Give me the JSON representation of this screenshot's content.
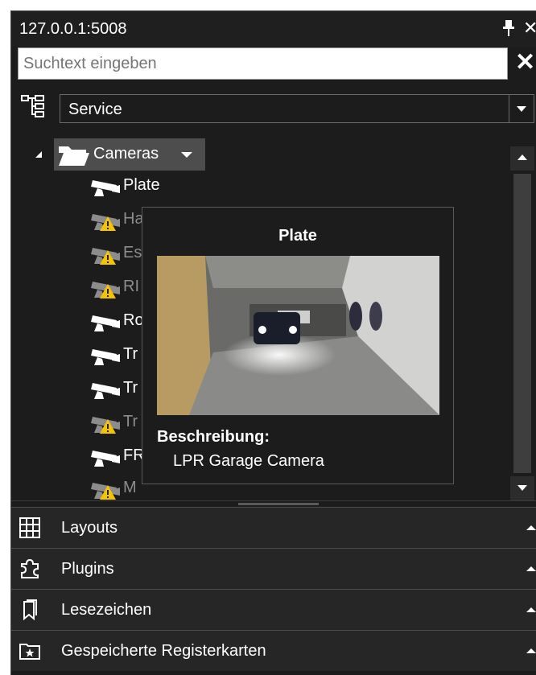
{
  "window": {
    "title": "127.0.0.1:5008"
  },
  "search": {
    "placeholder": "Suchtext eingeben",
    "value": ""
  },
  "view_selector": {
    "selected": "Service"
  },
  "tree": {
    "root": {
      "label": "Cameras",
      "icon": "folder-icon"
    },
    "items": [
      {
        "label": "Plate",
        "status": "ok"
      },
      {
        "label": "Ha",
        "status": "warning"
      },
      {
        "label": "Es",
        "status": "warning"
      },
      {
        "label": "RI",
        "status": "warning"
      },
      {
        "label": "Ro",
        "status": "ok"
      },
      {
        "label": "Tr",
        "status": "ok"
      },
      {
        "label": "Tr",
        "status": "ok"
      },
      {
        "label": "Tr",
        "status": "warning"
      },
      {
        "label": "FR",
        "status": "ok"
      },
      {
        "label": "M",
        "status": "warning"
      }
    ]
  },
  "tooltip": {
    "title": "Plate",
    "description_label": "Beschreibung:",
    "description": "LPR Garage Camera"
  },
  "sections": [
    {
      "label": "Layouts",
      "icon": "grid-icon"
    },
    {
      "label": "Plugins",
      "icon": "puzzle-icon"
    },
    {
      "label": "Lesezeichen",
      "icon": "bookmark-icon"
    },
    {
      "label": "Gespeicherte Registerkarten",
      "icon": "saved-tabs-icon"
    }
  ],
  "colors": {
    "panel_bg": "#1c1c1c",
    "selected_bg": "#4d4d4d",
    "warning": "#f5c400",
    "text": "#ffffff",
    "dim_text": "#8c8c8c"
  }
}
